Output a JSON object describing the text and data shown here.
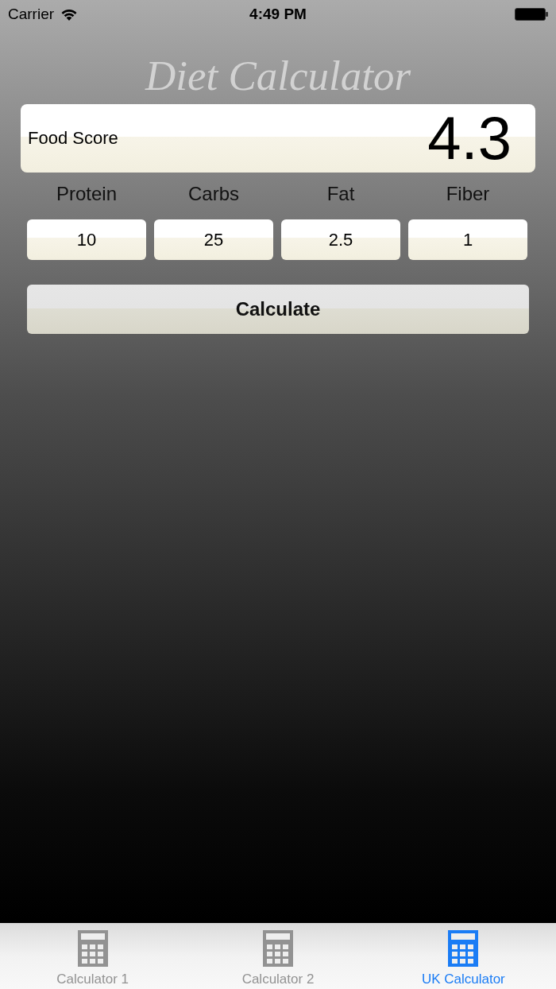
{
  "status_bar": {
    "carrier": "Carrier",
    "time": "4:49 PM"
  },
  "title": "Diet Calculator",
  "score": {
    "label": "Food Score",
    "value": "4.3"
  },
  "nutrients": [
    {
      "label": "Protein",
      "value": "10"
    },
    {
      "label": "Carbs",
      "value": "25"
    },
    {
      "label": "Fat",
      "value": "2.5"
    },
    {
      "label": "Fiber",
      "value": "1"
    }
  ],
  "calculate_button": "Calculate",
  "tab_bar": [
    {
      "label": "Calculator 1",
      "selected": false
    },
    {
      "label": "Calculator 2",
      "selected": false
    },
    {
      "label": "UK Calculator",
      "selected": true
    }
  ]
}
